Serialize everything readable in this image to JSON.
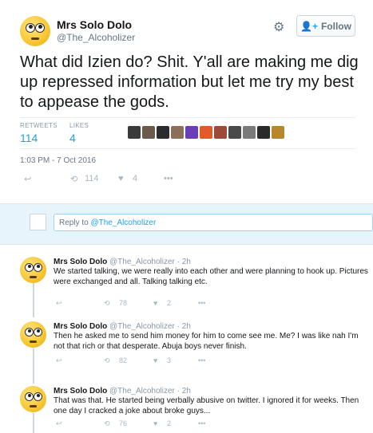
{
  "main_tweet": {
    "name": "Mrs Solo Dolo",
    "handle": "@The_Alcoholizer",
    "follow_label": "Follow",
    "text": "What did Izien do? Shit. Y'all are making me dig up repressed information but let me try my best to appease the gods.",
    "retweets_label": "RETWEETS",
    "retweets": "114",
    "likes_label": "LIKES",
    "likes": "4",
    "timestamp": "1:03 PM - 7 Oct 2016",
    "retweet_count": "114",
    "like_count": "4",
    "liker_colors": [
      "#3a3a3a",
      "#6b5a4a",
      "#2c2c2c",
      "#8c6f5a",
      "#6a3fb5",
      "#e05a2b",
      "#9c4a3a",
      "#4a4a4a",
      "#7a7a7a",
      "#2a2a2a",
      "#b8862c"
    ]
  },
  "reply_bar": {
    "prefix": "Reply to ",
    "mention": "@The_Alcoholizer"
  },
  "replies": [
    {
      "name": "Mrs Solo Dolo",
      "meta": "@The_Alcoholizer · 2h",
      "text": "We started talking, we were really into each other and were planning to hook up. Pictures were exchanged and all. Talking talking etc.",
      "retweets": "78",
      "likes": "2"
    },
    {
      "name": "Mrs Solo Dolo",
      "meta": "@The_Alcoholizer · 2h",
      "text": "Then he asked me to send him money for him to come see me. Me? I was like nah I'm not that rich or that desperate. Abuja boys never finish.",
      "retweets": "82",
      "likes": "3"
    },
    {
      "name": "Mrs Solo Dolo",
      "meta": "@The_Alcoholizer · 2h",
      "text": "That was that. He started being verbally abusive on twitter. I ignored it for weeks. Then one day I cracked a joke about broke guys...",
      "retweets": "76",
      "likes": "2"
    }
  ],
  "colors": {
    "accent": "#1da1f2",
    "muted": "#8899a6",
    "reply_bar_bg": "#e8f4fb"
  },
  "icons": [
    "reply-icon",
    "retweet-icon",
    "heart-icon",
    "more-icon",
    "gear-icon",
    "follow-user-icon"
  ]
}
